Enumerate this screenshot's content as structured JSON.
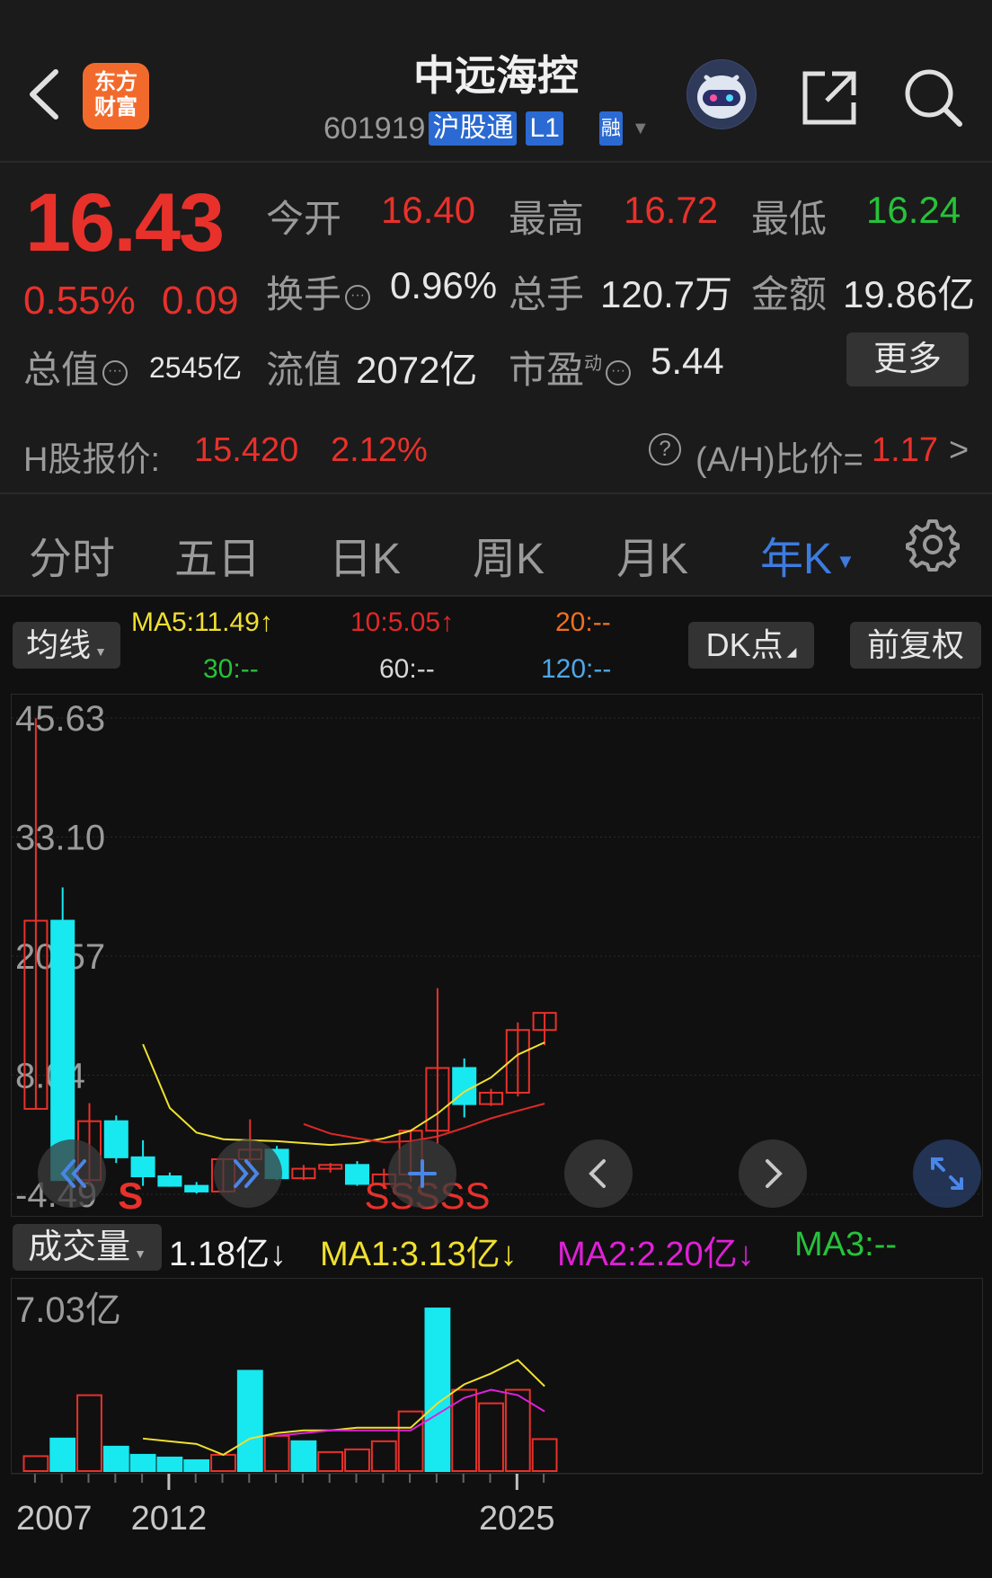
{
  "header": {
    "stock_name": "中远海控",
    "stock_code": "601919",
    "badge_connect": "沪股通",
    "badge_level": "L1",
    "badge_margin": "融",
    "logo_text_1": "东方",
    "logo_text_2": "财富"
  },
  "quote": {
    "price": "16.43",
    "change_pct": "0.55%",
    "change_amt": "0.09",
    "open_label": "今开",
    "open_value": "16.40",
    "high_label": "最高",
    "high_value": "16.72",
    "low_label": "最低",
    "low_value": "16.24",
    "turnover_label": "换手",
    "turnover_value": "0.96%",
    "volume_label": "总手",
    "volume_value": "120.7万",
    "amount_label": "金额",
    "amount_value": "19.86亿",
    "mktcap_label": "总值",
    "mktcap_value": "2545亿",
    "float_label": "流值",
    "float_value": "2072亿",
    "pe_label": "市盈",
    "pe_sup": "动",
    "pe_value": "5.44",
    "more_label": "更多",
    "hk_label": "H股报价:",
    "hk_price": "15.420",
    "hk_pct": "2.12%",
    "ah_label": "(A/H)比价=",
    "ah_value": "1.17",
    "ah_arrow": ">"
  },
  "tabs": [
    {
      "label": "分时"
    },
    {
      "label": "五日"
    },
    {
      "label": "日K"
    },
    {
      "label": "周K"
    },
    {
      "label": "月K"
    },
    {
      "label": "年K"
    }
  ],
  "chart_controls": {
    "ma_select": "均线",
    "ma5": "MA5:11.49↑",
    "ma10": "10:5.05↑",
    "ma20": "20:--",
    "ma30": "30:--",
    "ma60": "60:--",
    "ma120": "120:--",
    "dk_label": "DK点",
    "adjust_label": "前复权",
    "vol_select": "成交量",
    "vol_value": "1.18亿↓",
    "vol_ma1": "MA1:3.13亿↓",
    "vol_ma2": "MA2:2.20亿↓",
    "vol_ma3": "MA3:--",
    "signal_s": "S",
    "signal_ssss": "SSSSS"
  },
  "colors": {
    "up": "#e8312b",
    "down": "#18e8f0",
    "ma5": "#f0e030",
    "ma10": "#e02828",
    "accent": "#3d7be0"
  },
  "chart_data": {
    "type": "candlestick",
    "title": "",
    "x_tick_labels": [
      "2007",
      "2012",
      "2025"
    ],
    "y_tick_labels": [
      "45.63",
      "33.10",
      "20.57",
      "8.04",
      "-4.49"
    ],
    "ylim": [
      -4.49,
      45.63
    ],
    "candles": [
      {
        "year": 2007,
        "open": 4.5,
        "close": 24.3,
        "high": 45.6,
        "low": 4.5
      },
      {
        "year": 2008,
        "open": 24.3,
        "close": -3.0,
        "high": 27.8,
        "low": -3.0
      },
      {
        "year": 2009,
        "open": -3.0,
        "close": 3.2,
        "high": 5.1,
        "low": -3.6
      },
      {
        "year": 2010,
        "open": 3.2,
        "close": -0.6,
        "high": 3.8,
        "low": -1.2
      },
      {
        "year": 2011,
        "open": -0.6,
        "close": -2.6,
        "high": 1.2,
        "low": -3.6
      },
      {
        "year": 2012,
        "open": -2.6,
        "close": -3.6,
        "high": -2.2,
        "low": -3.7
      },
      {
        "year": 2013,
        "open": -3.6,
        "close": -4.2,
        "high": -3.2,
        "low": -4.4
      },
      {
        "year": 2014,
        "open": -4.2,
        "close": -0.8,
        "high": -0.8,
        "low": -4.3
      },
      {
        "year": 2015,
        "open": -0.8,
        "close": 0.2,
        "high": 3.4,
        "low": -1.2
      },
      {
        "year": 2016,
        "open": 0.2,
        "close": -2.8,
        "high": 0.6,
        "low": -3.0
      },
      {
        "year": 2017,
        "open": -2.8,
        "close": -1.8,
        "high": -1.4,
        "low": -3.0
      },
      {
        "year": 2018,
        "open": -1.8,
        "close": -1.4,
        "high": -1.2,
        "low": -2.2
      },
      {
        "year": 2019,
        "open": -1.4,
        "close": -3.4,
        "high": -1.0,
        "low": -3.6
      },
      {
        "year": 2020,
        "open": -3.4,
        "close": -2.4,
        "high": -1.8,
        "low": -3.9
      },
      {
        "year": 2021,
        "open": -2.4,
        "close": 2.2,
        "high": 2.2,
        "low": -3.2
      },
      {
        "year": 2022,
        "open": 2.2,
        "close": 8.8,
        "high": 17.2,
        "low": 0.8
      },
      {
        "year": 2023,
        "open": 8.8,
        "close": 5.0,
        "high": 9.8,
        "low": 3.6
      },
      {
        "year": 2024,
        "open": 5.0,
        "close": 6.2,
        "high": 6.6,
        "low": 4.8
      },
      {
        "year": 2025,
        "open": 6.2,
        "close": 12.8,
        "high": 13.6,
        "low": 5.8
      },
      {
        "year": 2026,
        "open": 12.8,
        "close": 14.6,
        "high": 14.6,
        "low": 11.2
      }
    ],
    "series": [
      {
        "name": "MA5",
        "values": [
          null,
          null,
          null,
          null,
          11.3,
          4.6,
          2.0,
          1.3,
          1.2,
          1.1,
          0.9,
          0.7,
          0.9,
          1.4,
          2.2,
          4.0,
          6.3,
          7.8,
          10.2,
          11.49
        ]
      },
      {
        "name": "MA10",
        "values": [
          null,
          null,
          null,
          null,
          null,
          null,
          null,
          null,
          null,
          null,
          2.9,
          1.9,
          1.4,
          1.0,
          1.1,
          1.6,
          2.5,
          3.5,
          4.3,
          5.05
        ]
      }
    ],
    "volume": {
      "ylim_label": "7.03亿",
      "ymax": 7.03,
      "up": [
        true,
        false,
        true,
        false,
        false,
        false,
        false,
        true,
        false,
        true,
        false,
        true,
        true,
        true,
        true,
        false,
        true,
        true,
        true,
        true
      ],
      "values": [
        0.55,
        1.2,
        2.8,
        0.9,
        0.6,
        0.5,
        0.4,
        0.6,
        3.7,
        1.3,
        1.1,
        0.7,
        0.8,
        1.1,
        2.2,
        6.0,
        3.0,
        2.5,
        3.0,
        1.18
      ],
      "ma1": [
        null,
        null,
        null,
        null,
        1.2,
        1.1,
        1.0,
        0.6,
        1.2,
        1.4,
        1.5,
        1.5,
        1.6,
        1.6,
        1.6,
        2.5,
        3.2,
        3.6,
        4.1,
        3.13
      ],
      "ma2": [
        null,
        null,
        null,
        null,
        null,
        null,
        null,
        null,
        null,
        1.3,
        1.4,
        1.5,
        1.5,
        1.5,
        1.5,
        2.1,
        2.7,
        3.0,
        2.8,
        2.2
      ]
    }
  }
}
